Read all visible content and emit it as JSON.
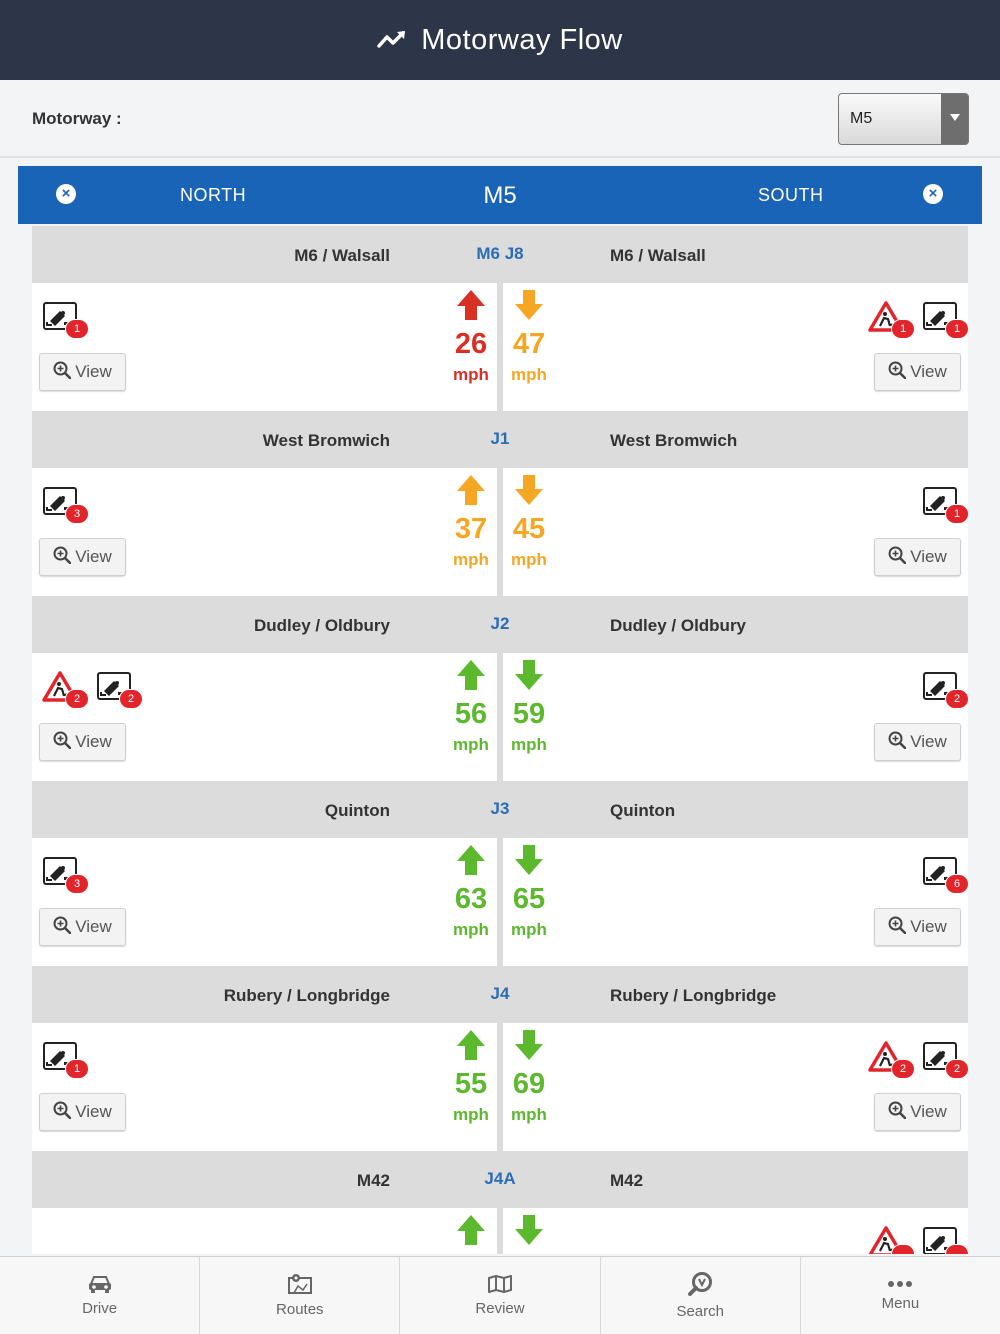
{
  "header": {
    "title": "Motorway Flow",
    "icon": "flow-trend-icon"
  },
  "selector": {
    "label": "Motorway :",
    "selected": "M5"
  },
  "direction_bar": {
    "north": "NORTH",
    "motorway": "M5",
    "south": "SOUTH"
  },
  "view_label": "View",
  "speed_unit": "mph",
  "colors": {
    "red": "#d93025",
    "amber": "#f5a623",
    "green": "#5cb82d",
    "header": "#2c3648",
    "blue_bar": "#1a64b8"
  },
  "junctions": [
    {
      "junction": "M6 J8",
      "left": "M6 / Walsall",
      "right": "M6 / Walsall",
      "north": {
        "speed": "26",
        "color": "red",
        "arrow": "up"
      },
      "south": {
        "speed": "47",
        "color": "amber",
        "arrow": "down"
      },
      "left_icons": [
        {
          "type": "camera",
          "count": "1"
        }
      ],
      "right_icons": [
        {
          "type": "camera",
          "count": "1"
        },
        {
          "type": "roadworks",
          "count": "1"
        }
      ]
    },
    {
      "junction": "J1",
      "left": "West Bromwich",
      "right": "West Bromwich",
      "north": {
        "speed": "37",
        "color": "amber",
        "arrow": "up"
      },
      "south": {
        "speed": "45",
        "color": "amber",
        "arrow": "down"
      },
      "left_icons": [
        {
          "type": "camera",
          "count": "3"
        }
      ],
      "right_icons": [
        {
          "type": "camera",
          "count": "1"
        }
      ]
    },
    {
      "junction": "J2",
      "left": "Dudley / Oldbury",
      "right": "Dudley / Oldbury",
      "north": {
        "speed": "56",
        "color": "green",
        "arrow": "up"
      },
      "south": {
        "speed": "59",
        "color": "green",
        "arrow": "down"
      },
      "left_icons": [
        {
          "type": "roadworks",
          "count": "2"
        },
        {
          "type": "camera",
          "count": "2"
        }
      ],
      "right_icons": [
        {
          "type": "camera",
          "count": "2"
        }
      ]
    },
    {
      "junction": "J3",
      "left": "Quinton",
      "right": "Quinton",
      "north": {
        "speed": "63",
        "color": "green",
        "arrow": "up"
      },
      "south": {
        "speed": "65",
        "color": "green",
        "arrow": "down"
      },
      "left_icons": [
        {
          "type": "camera",
          "count": "3"
        }
      ],
      "right_icons": [
        {
          "type": "camera",
          "count": "6"
        }
      ]
    },
    {
      "junction": "J4",
      "left": "Rubery / Longbridge",
      "right": "Rubery / Longbridge",
      "north": {
        "speed": "55",
        "color": "green",
        "arrow": "up"
      },
      "south": {
        "speed": "69",
        "color": "green",
        "arrow": "down"
      },
      "left_icons": [
        {
          "type": "camera",
          "count": "1"
        }
      ],
      "right_icons": [
        {
          "type": "camera",
          "count": "2"
        },
        {
          "type": "roadworks",
          "count": "2"
        }
      ]
    },
    {
      "junction": "J4A",
      "left": "M42",
      "right": "M42",
      "north": {
        "speed": "",
        "color": "green",
        "arrow": "up"
      },
      "south": {
        "speed": "",
        "color": "green",
        "arrow": "down"
      },
      "left_icons": [],
      "right_icons": [
        {
          "type": "camera",
          "count": ""
        },
        {
          "type": "roadworks",
          "count": ""
        }
      ]
    }
  ],
  "tabs": [
    {
      "label": "Drive",
      "icon": "car-icon"
    },
    {
      "label": "Routes",
      "icon": "map-pin-icon"
    },
    {
      "label": "Review",
      "icon": "map-icon"
    },
    {
      "label": "Search",
      "icon": "search-icon"
    },
    {
      "label": "Menu",
      "icon": "more-icon"
    }
  ]
}
